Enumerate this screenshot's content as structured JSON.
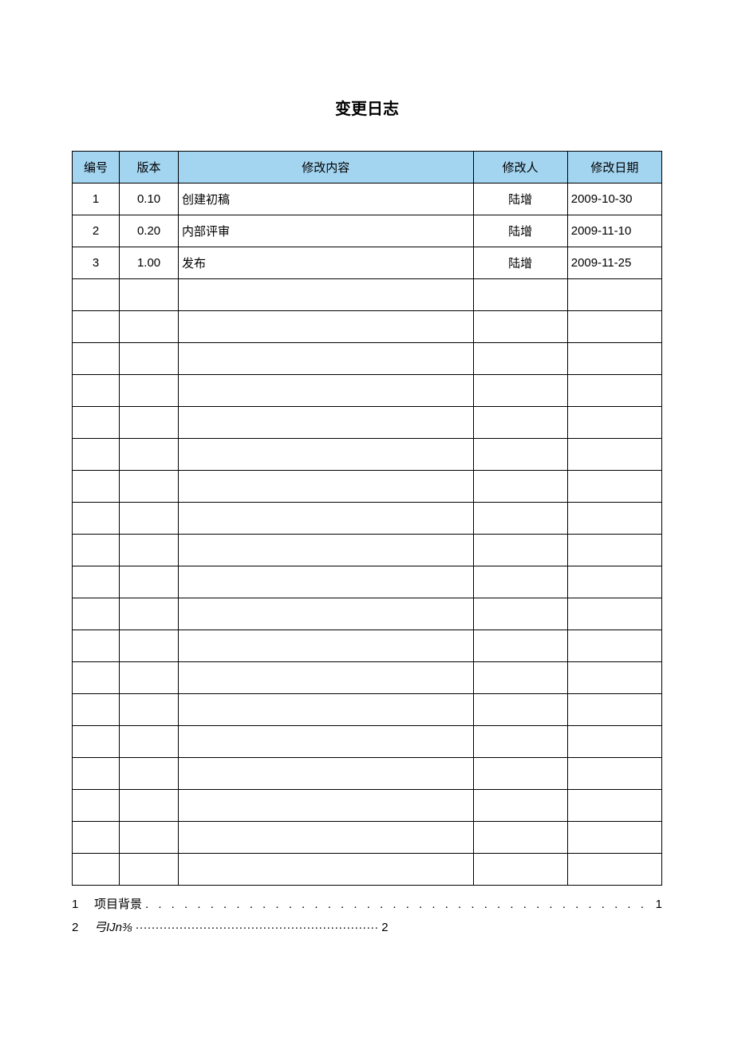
{
  "title": "变更日志",
  "headers": {
    "id": "编号",
    "version": "版本",
    "content": "修改内容",
    "author": "修改人",
    "date": "修改日期"
  },
  "rows": [
    {
      "id": "1",
      "version": "0.10",
      "content": "创建初稿",
      "author": "陆增",
      "date": "2009-10-30"
    },
    {
      "id": "2",
      "version": "0.20",
      "content": "内部评审",
      "author": "陆增",
      "date": "2009-11-10"
    },
    {
      "id": "3",
      "version": "1.00",
      "content": "发布",
      "author": "陆增",
      "date": "2009-11-25"
    }
  ],
  "empty_row_count": 19,
  "toc": [
    {
      "num": "1",
      "label": "项目背景",
      "page": "1",
      "dots": ". . . . . . . . . . . . . . . . . . . . . . . . . . . . . . . . . . . . . . . . . . . . . . . . . . . . . . . . . ."
    },
    {
      "num": "2",
      "label": "弓IJn⅜",
      "page": "2",
      "dots": "·····························································",
      "italic": true,
      "short": true
    }
  ]
}
